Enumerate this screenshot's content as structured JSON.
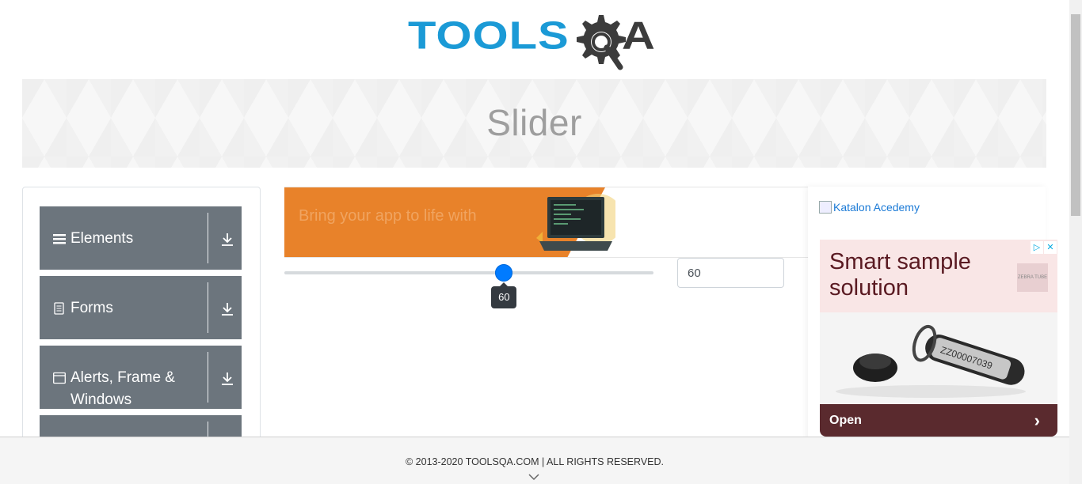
{
  "logo": {
    "text": "TOOLS",
    "suffix": "A",
    "brand_color": "#1b9ad6",
    "dark_color": "#3c3c3c"
  },
  "banner": {
    "title": "Slider"
  },
  "sidebar": {
    "groups": [
      {
        "label": "Elements",
        "icon": "hamburger-icon"
      },
      {
        "label": "Forms",
        "icon": "document-icon"
      },
      {
        "label": "Alerts, Frame & Windows",
        "icon": "window-icon"
      },
      {
        "label": "",
        "icon": ""
      }
    ]
  },
  "ad_banner": {
    "text": "Bring your app to life with"
  },
  "slider": {
    "min": 0,
    "max": 100,
    "value": 60,
    "tooltip": "60",
    "accent": "#007bff"
  },
  "value_input": {
    "value": "60"
  },
  "right_ad": {
    "broken_image_alt": "Katalon Acedemy",
    "headline": "Smart sample solution",
    "brand": "ZEBRA TUBE",
    "product_code": "ZZ00007039",
    "cta": "Open"
  },
  "footer": {
    "text": "© 2013-2020 TOOLSQA.COM | ALL RIGHTS RESERVED."
  }
}
